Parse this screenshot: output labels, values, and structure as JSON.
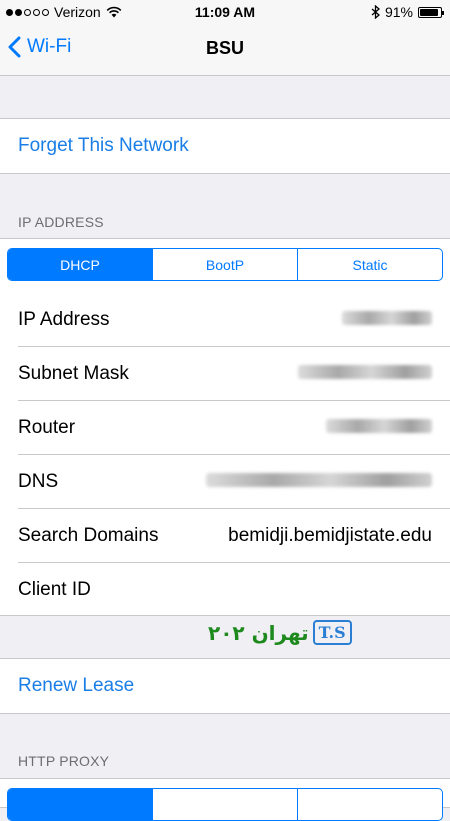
{
  "status_bar": {
    "carrier": "Verizon",
    "time": "11:09 AM",
    "battery": "91%",
    "battery_level": 0.91,
    "signal_bars": 2,
    "signal_total": 5
  },
  "nav": {
    "back_label": "Wi-Fi",
    "title": "BSU"
  },
  "forget_label": "Forget This Network",
  "ip_section": {
    "header": "IP ADDRESS",
    "segments": [
      "DHCP",
      "BootP",
      "Static"
    ],
    "selected_segment": "DHCP",
    "rows": [
      {
        "label": "IP Address",
        "value": "",
        "blurred": true
      },
      {
        "label": "Subnet Mask",
        "value": "",
        "blurred": true
      },
      {
        "label": "Router",
        "value": "",
        "blurred": true
      },
      {
        "label": "DNS",
        "value": "",
        "blurred": true
      },
      {
        "label": "Search Domains",
        "value": "bemidji.bemidjistate.edu",
        "blurred": false
      },
      {
        "label": "Client ID",
        "value": "",
        "blurred": false
      }
    ]
  },
  "renew_label": "Renew Lease",
  "proxy_section": {
    "header": "HTTP PROXY"
  },
  "watermark": {
    "logo_text": "T.S",
    "brand_text": "تهران ۲۰۲"
  },
  "colors": {
    "accent": "#007aff",
    "link": "#1a7ee6",
    "background": "#efeff4"
  }
}
